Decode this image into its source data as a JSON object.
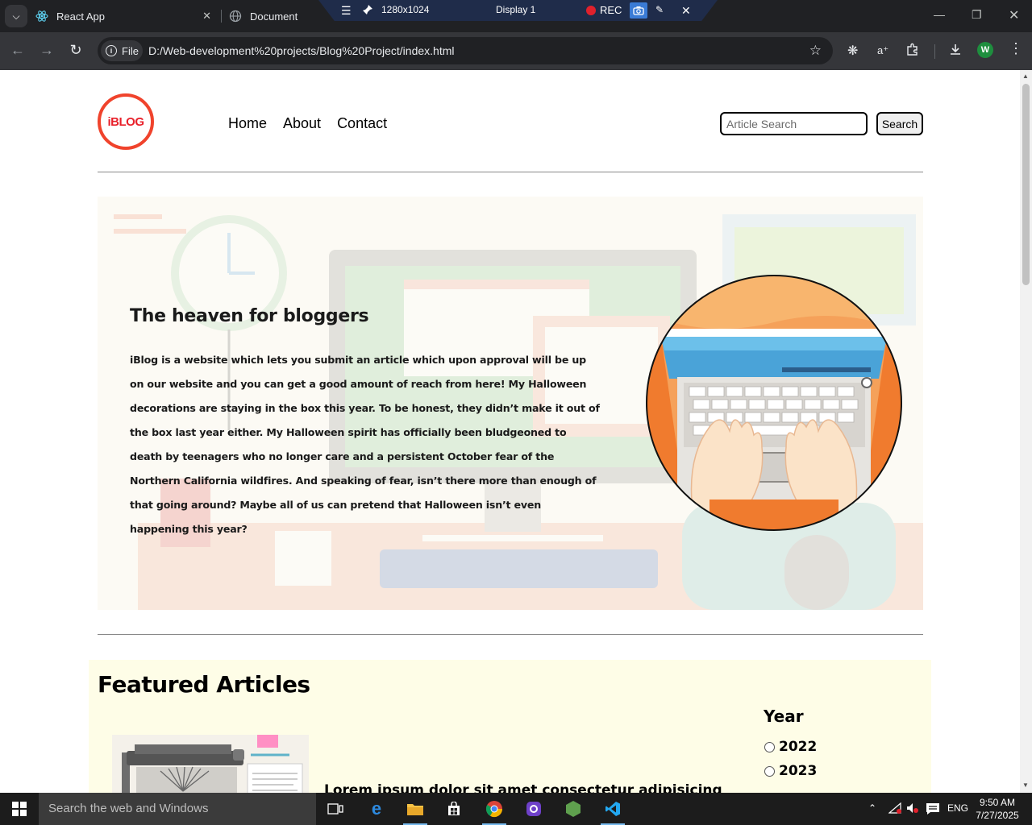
{
  "browser": {
    "tabs": [
      {
        "title": "React App",
        "active": false
      },
      {
        "title": "Document",
        "active": true
      }
    ],
    "recorder": {
      "resolution": "1280x1024",
      "display": "Display 1",
      "rec_label": "REC"
    },
    "address": {
      "scheme_label": "File",
      "url": "D:/Web-development%20projects/Blog%20Project/index.html"
    },
    "profile_initial": "W"
  },
  "page": {
    "logo_text": "iBLOG",
    "nav": [
      "Home",
      "About",
      "Contact"
    ],
    "search": {
      "placeholder": "Article Search",
      "button_label": "Search"
    },
    "hero": {
      "title": "The heaven for bloggers",
      "text": "iBlog is a website which lets you submit an article which upon approval will be up on our website and you can get a good amount of reach from here! My Halloween decorations are staying in the box this year. To be honest, they didn’t make it out of the box last year either. My Halloween spirit has officially been bludgeoned to death by teenagers who no longer care and a persistent October fear of the Northern California wildfires. And speaking of fear, isn’t there more than enough of that going around? Maybe all of us can pretend that Halloween isn’t even happening this year?"
    },
    "featured": {
      "title": "Featured Articles",
      "first_article_heading": "Lorem ipsum dolor sit amet consectetur adipisicing",
      "year_filter": {
        "label": "Year",
        "options": [
          "2022",
          "2023"
        ]
      }
    }
  },
  "taskbar": {
    "search_placeholder": "Search the web and Windows",
    "language": "ENG",
    "time": "9:50 AM",
    "date": "7/27/2025"
  },
  "colors": {
    "logo_red": "#f0432c",
    "featured_bg": "#fefde7",
    "hero_bg": "#fcfaf4"
  }
}
